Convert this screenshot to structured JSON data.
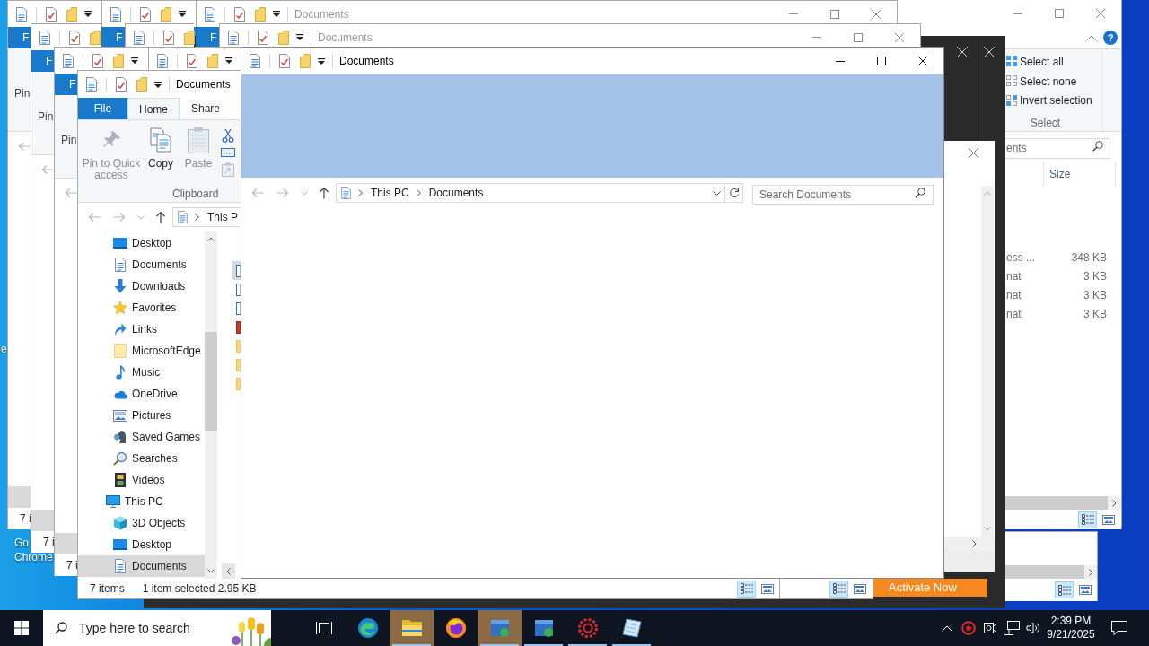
{
  "desktop": {
    "labels": [
      {
        "lines": [
          "e"
        ]
      },
      {
        "lines": [
          "Go",
          "Chrome"
        ]
      }
    ]
  },
  "right_window": {
    "active": false,
    "title_buttons": [
      {
        "kind": "minimize"
      },
      {
        "kind": "maximize"
      },
      {
        "kind": "close"
      }
    ],
    "help": "?",
    "select_group": {
      "label": "Select",
      "items": [
        {
          "kind": "select-all",
          "label": "Select all"
        },
        {
          "kind": "select-none",
          "label": "Select none"
        },
        {
          "kind": "invert",
          "label": "Invert selection"
        }
      ]
    },
    "search": {
      "placeholder": "ents"
    },
    "columns": [
      "Size"
    ],
    "rows": [
      {
        "cells": [
          "ess ...",
          "348 KB"
        ]
      },
      {
        "cells": [
          "nat",
          "3 KB"
        ]
      },
      {
        "cells": [
          "nat",
          "3 KB"
        ]
      },
      {
        "cells": [
          "nat",
          "3 KB"
        ]
      }
    ],
    "view_buttons": [
      {
        "kind": "details",
        "selected": true
      },
      {
        "kind": "large-icons",
        "selected": false
      }
    ]
  },
  "corner_window": {
    "view_buttons": [
      {
        "kind": "details",
        "selected": true
      },
      {
        "kind": "large-icons",
        "selected": false
      }
    ]
  },
  "dark_window": {
    "buttons": [
      {
        "kind": "close"
      },
      {
        "kind": "close"
      }
    ],
    "dialog": {
      "buttons": [
        {
          "kind": "close"
        }
      ]
    },
    "action": "Activate Now"
  },
  "background_windows": [
    {
      "quick_access": [
        {
          "kind": "document"
        },
        {
          "kind": "properties"
        },
        {
          "kind": "folder"
        },
        {
          "kind": "customize"
        }
      ],
      "tab": "F",
      "ribbon_label": "Pin",
      "nav_buttons": [
        {
          "kind": "back",
          "disabled": true
        }
      ],
      "selected_row": true,
      "status": "7 i"
    },
    {
      "quick_access": [
        {
          "kind": "document"
        },
        {
          "kind": "properties"
        },
        {
          "kind": "folder"
        }
      ],
      "tab": "F",
      "ribbon_label": "Pin",
      "nav_buttons": [
        {
          "kind": "back",
          "disabled": true
        }
      ],
      "selected_row": true,
      "status": "7 i"
    },
    {
      "quick_access": [
        {
          "kind": "document"
        },
        {
          "kind": "properties"
        },
        {
          "kind": "folder"
        },
        {
          "kind": "customize"
        }
      ],
      "tab": "F"
    },
    {
      "quick_access": [
        {
          "kind": "document"
        },
        {
          "kind": "properties"
        },
        {
          "kind": "folder"
        }
      ]
    },
    {
      "quick_access": [
        {
          "kind": "document"
        },
        {
          "kind": "properties"
        },
        {
          "kind": "folder"
        },
        {
          "kind": "customize"
        }
      ],
      "title": "Documents",
      "active": false,
      "title_buttons": [
        {
          "kind": "minimize"
        },
        {
          "kind": "maximize"
        },
        {
          "kind": "close"
        }
      ],
      "tab": "F"
    },
    {
      "quick_access": [
        {
          "kind": "document"
        },
        {
          "kind": "properties"
        },
        {
          "kind": "folder"
        },
        {
          "kind": "customize"
        }
      ],
      "title": "Documents",
      "active": false,
      "title_buttons": [
        {
          "kind": "minimize"
        },
        {
          "kind": "maximize"
        },
        {
          "kind": "close"
        }
      ]
    },
    {
      "quick_access": [
        {
          "kind": "document"
        },
        {
          "kind": "properties"
        },
        {
          "kind": "folder"
        },
        {
          "kind": "customize"
        }
      ],
      "tab": "F",
      "ribbon_label": "Pin",
      "nav_buttons": [
        {
          "kind": "back",
          "disabled": true
        }
      ],
      "selected_row": true,
      "status": "7 i"
    },
    {
      "quick_access": [
        {
          "kind": "document"
        },
        {
          "kind": "properties"
        },
        {
          "kind": "folder"
        },
        {
          "kind": "customize"
        }
      ]
    }
  ],
  "middle_window": {
    "view_buttons": [
      {
        "kind": "details",
        "selected": true
      },
      {
        "kind": "large-icons",
        "selected": false
      }
    ]
  },
  "left_window": {
    "title": "Documents",
    "active": true,
    "quick_access": [
      {
        "kind": "document"
      },
      {
        "kind": "properties"
      },
      {
        "kind": "folder"
      },
      {
        "kind": "customize"
      }
    ],
    "tabs": [
      {
        "label": "File",
        "kind": "file",
        "selected": false
      },
      {
        "label": "Home",
        "kind": "tab",
        "selected": true
      },
      {
        "label": "Share",
        "kind": "tab",
        "selected": false
      }
    ],
    "clipboard": {
      "label": "Clipboard",
      "large_buttons": [
        {
          "kind": "pin",
          "label": "Pin to Quick access",
          "disabled": true
        },
        {
          "kind": "copy",
          "label": "Copy",
          "disabled": false
        },
        {
          "kind": "paste",
          "label": "Paste",
          "disabled": true
        }
      ],
      "small_buttons": [
        {
          "kind": "cut",
          "disabled": false
        },
        {
          "kind": "copy-path",
          "disabled": false
        },
        {
          "kind": "paste-shortcut",
          "disabled": true
        }
      ]
    },
    "nav_buttons": [
      {
        "kind": "back",
        "disabled": true
      },
      {
        "kind": "forward",
        "disabled": true
      },
      {
        "kind": "recent",
        "disabled": true
      },
      {
        "kind": "up",
        "disabled": false
      }
    ],
    "address": {
      "segments": [
        "This P"
      ]
    },
    "nav_tree": [
      {
        "children": [
          {
            "label": "Desktop",
            "kind": "desktop",
            "selected": false
          },
          {
            "label": "Documents",
            "kind": "documents",
            "selected": false
          },
          {
            "label": "Downloads",
            "kind": "downloads",
            "selected": false
          },
          {
            "label": "Favorites",
            "kind": "favorites",
            "selected": false
          },
          {
            "label": "Links",
            "kind": "links",
            "selected": false
          },
          {
            "label": "MicrosoftEdge",
            "kind": "folder",
            "selected": false
          },
          {
            "label": "Music",
            "kind": "music",
            "selected": false
          },
          {
            "label": "OneDrive",
            "kind": "onedrive",
            "selected": false
          },
          {
            "label": "Pictures",
            "kind": "pictures",
            "selected": false
          },
          {
            "label": "Saved Games",
            "kind": "games",
            "selected": false
          },
          {
            "label": "Searches",
            "kind": "searches",
            "selected": false
          },
          {
            "label": "Videos",
            "kind": "videos",
            "selected": false
          }
        ]
      },
      {
        "label": "This PC",
        "kind": "computer",
        "selected": false,
        "children": [
          {
            "label": "3D Objects",
            "kind": "objects",
            "selected": false
          },
          {
            "label": "Desktop",
            "kind": "desktop",
            "selected": false
          },
          {
            "label": "Documents",
            "kind": "documents",
            "selected": true
          }
        ]
      }
    ],
    "file_rows": [
      {
        "kind": "document",
        "selected": true
      },
      {
        "kind": "document",
        "selected": false
      },
      {
        "kind": "document",
        "selected": false
      },
      {
        "kind": "red",
        "selected": false
      },
      {
        "kind": "folder",
        "selected": false
      },
      {
        "kind": "folder",
        "selected": false
      },
      {
        "kind": "folder",
        "selected": false
      }
    ],
    "status": {
      "count": "7 items",
      "selection": "1 item selected 2.95 KB"
    },
    "view_buttons": [
      {
        "kind": "details",
        "selected": true
      },
      {
        "kind": "large-icons",
        "selected": false
      }
    ]
  },
  "front_window": {
    "title": "Documents",
    "active": true,
    "quick_access": [
      {
        "kind": "document"
      },
      {
        "kind": "properties"
      },
      {
        "kind": "folder"
      },
      {
        "kind": "customize"
      }
    ],
    "title_buttons": [
      {
        "kind": "minimize"
      },
      {
        "kind": "maximize"
      },
      {
        "kind": "close"
      }
    ],
    "nav_buttons": [
      {
        "kind": "back",
        "disabled": true
      },
      {
        "kind": "forward",
        "disabled": true
      },
      {
        "kind": "recent",
        "disabled": true
      },
      {
        "kind": "up",
        "disabled": false
      }
    ],
    "address": {
      "segments": [
        "This PC",
        "Documents"
      ]
    },
    "search": {
      "placeholder": "Search Documents"
    }
  },
  "taskbar": {
    "search": {
      "placeholder": "Type here to search"
    },
    "apps": [
      {
        "kind": "taskview",
        "open": false,
        "selected": false
      },
      {
        "kind": "swirl",
        "open": false,
        "selected": false
      },
      {
        "kind": "folder",
        "open": true,
        "selected": true
      },
      {
        "kind": "globe",
        "open": false,
        "selected": false
      },
      {
        "kind": "box",
        "open": true,
        "selected": true
      },
      {
        "kind": "box",
        "open": true,
        "selected": false
      },
      {
        "kind": "gear",
        "open": true,
        "selected": false
      },
      {
        "kind": "paper",
        "open": true,
        "selected": false
      }
    ],
    "time": "2:39 PM",
    "date": "9/21/2025"
  }
}
